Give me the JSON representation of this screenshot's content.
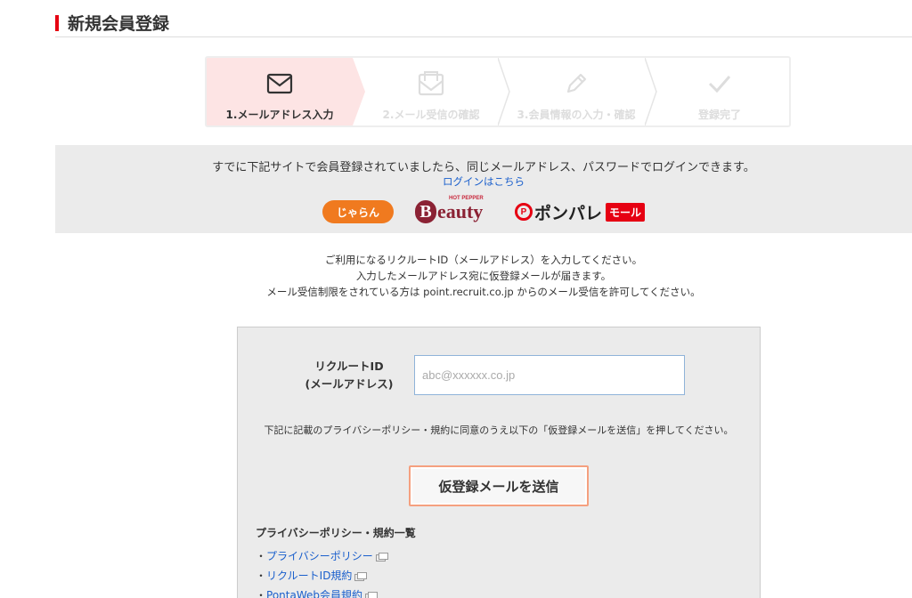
{
  "page": {
    "title": "新規会員登録"
  },
  "steps": [
    {
      "label": "1.メールアドレス入力",
      "icon": "envelope-icon",
      "active": true
    },
    {
      "label": "2.メール受信の確認",
      "icon": "envelope-open-icon",
      "active": false
    },
    {
      "label": "3.会員情報の入力・確認",
      "icon": "pencil-icon",
      "active": false
    },
    {
      "label": "登録完了",
      "icon": "check-icon",
      "active": false
    }
  ],
  "existing": {
    "message": "すでに下記サイトで会員登録されていましたら、同じメールアドレス、パスワードでログインできます。",
    "login_link": "ログインはこちら",
    "logos": {
      "jalan": "じゃらん",
      "beauty_small": "HOT PEPPER",
      "beauty_b": "B",
      "beauty_rest": "eauty",
      "ponpare_p": "P",
      "ponpare_main": "ポンパレ",
      "ponpare_badge": "モール"
    }
  },
  "intro": {
    "line1": "ご利用になるリクルートID（メールアドレス）を入力してください。",
    "line2": "入力したメールアドレス宛に仮登録メールが届きます。",
    "line3": "メール受信制限をされている方は point.recruit.co.jp からのメール受信を許可してください。"
  },
  "form": {
    "label_line1": "リクルートID",
    "label_line2": "(メールアドレス)",
    "email_placeholder": "abc@xxxxxx.co.jp",
    "email_value": "",
    "consent_text": "下記に記載のプライバシーポリシー・規約に同意のうえ以下の「仮登録メールを送信」を押してください。",
    "submit_label": "仮登録メールを送信"
  },
  "policies": {
    "title": "プライバシーポリシー・規約一覧",
    "bullet": "・",
    "items": [
      {
        "label": "プライバシーポリシー"
      },
      {
        "label": "リクルートID規約"
      },
      {
        "label": "PontaWeb会員規約"
      }
    ]
  },
  "colors": {
    "accent_red": "#e60012",
    "active_step_bg": "#fde4e4",
    "link_blue": "#1a5fcc",
    "button_border": "#f5a07f"
  }
}
